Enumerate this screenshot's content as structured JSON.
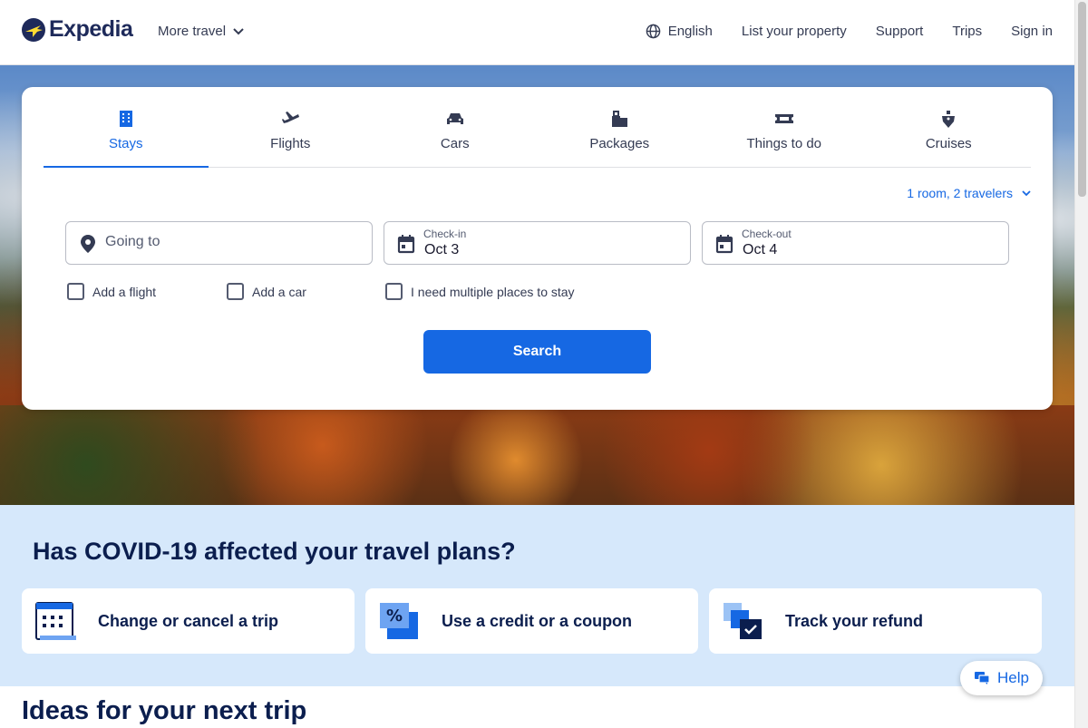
{
  "header": {
    "logo_text": "Expedia",
    "more_travel": "More travel",
    "language": "English",
    "list_property": "List your property",
    "support": "Support",
    "trips": "Trips",
    "sign_in": "Sign in"
  },
  "tabs": [
    {
      "label": "Stays",
      "icon": "building-icon",
      "active": true
    },
    {
      "label": "Flights",
      "icon": "plane-icon",
      "active": false
    },
    {
      "label": "Cars",
      "icon": "car-icon",
      "active": false
    },
    {
      "label": "Packages",
      "icon": "luggage-icon",
      "active": false
    },
    {
      "label": "Things to do",
      "icon": "ticket-icon",
      "active": false
    },
    {
      "label": "Cruises",
      "icon": "ship-icon",
      "active": false
    }
  ],
  "search": {
    "travelers": "1 room, 2 travelers",
    "going_to_placeholder": "Going to",
    "checkin_label": "Check-in",
    "checkin_value": "Oct 3",
    "checkout_label": "Check-out",
    "checkout_value": "Oct 4",
    "add_flight": "Add a flight",
    "add_car": "Add a car",
    "multiple_places": "I need multiple places to stay",
    "search_button": "Search"
  },
  "covid": {
    "title": "Has COVID-19 affected your travel plans?",
    "cards": [
      {
        "label": "Change or cancel a trip",
        "icon": "calendar-icon"
      },
      {
        "label": "Use a credit or a coupon",
        "icon": "coupon-icon"
      },
      {
        "label": "Track your refund",
        "icon": "refund-icon"
      }
    ]
  },
  "ideas_title": "Ideas for your next trip",
  "help_label": "Help",
  "colors": {
    "primary": "#1668e3",
    "navy": "#0b1e4e",
    "covid_bg": "#d6e8fb"
  }
}
